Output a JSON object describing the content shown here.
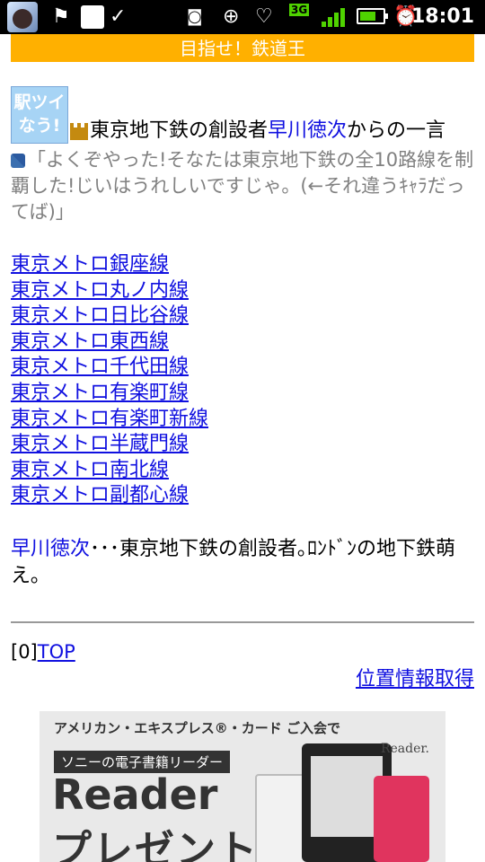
{
  "status_bar": {
    "time": "18:01",
    "network": "3G",
    "icons": [
      "avatar",
      "flag-icon",
      "cat-icon",
      "check-icon",
      "voicemail-icon",
      "gps-icon",
      "heart-icon",
      "signal-icon",
      "battery-icon",
      "alarm-icon"
    ]
  },
  "banner": {
    "title": "目指せ！鉄道王"
  },
  "badge": {
    "text_line1": "駅ツイ",
    "text_line2": "なう!"
  },
  "heading": {
    "prefix": "東京地下鉄の創設者",
    "name": "早川徳次",
    "suffix": "からの一言"
  },
  "quote": "「よくぞやった!そなたは東京地下鉄の全10路線を制覇した!じいはうれしいですじゃ。(←それ違うｷｬﾗだってば)」",
  "lines": [
    "東京メトロ銀座線",
    "東京メトロ丸ノ内線",
    "東京メトロ日比谷線",
    "東京メトロ東西線",
    "東京メトロ千代田線",
    "東京メトロ有楽町線",
    "東京メトロ有楽町新線",
    "東京メトロ半蔵門線",
    "東京メトロ南北線",
    "東京メトロ副都心線"
  ],
  "description": {
    "name": "早川徳次",
    "text": "･･･東京地下鉄の創設者｡ﾛﾝﾄﾞﾝの地下鉄萌え｡"
  },
  "footer": {
    "top_prefix": "[0]",
    "top_link": "TOP",
    "locate_link": "位置情報取得"
  },
  "ad": {
    "line1": "アメリカン・エキスプレス®・カード ご入会で",
    "tag": "ソニーの電子書籍リーダー",
    "reader": "Reader",
    "present": "プレゼント",
    "brand": "Reader."
  },
  "colors": {
    "link": "#1010e0",
    "banner": "#ffb000",
    "quote": "#808080"
  }
}
